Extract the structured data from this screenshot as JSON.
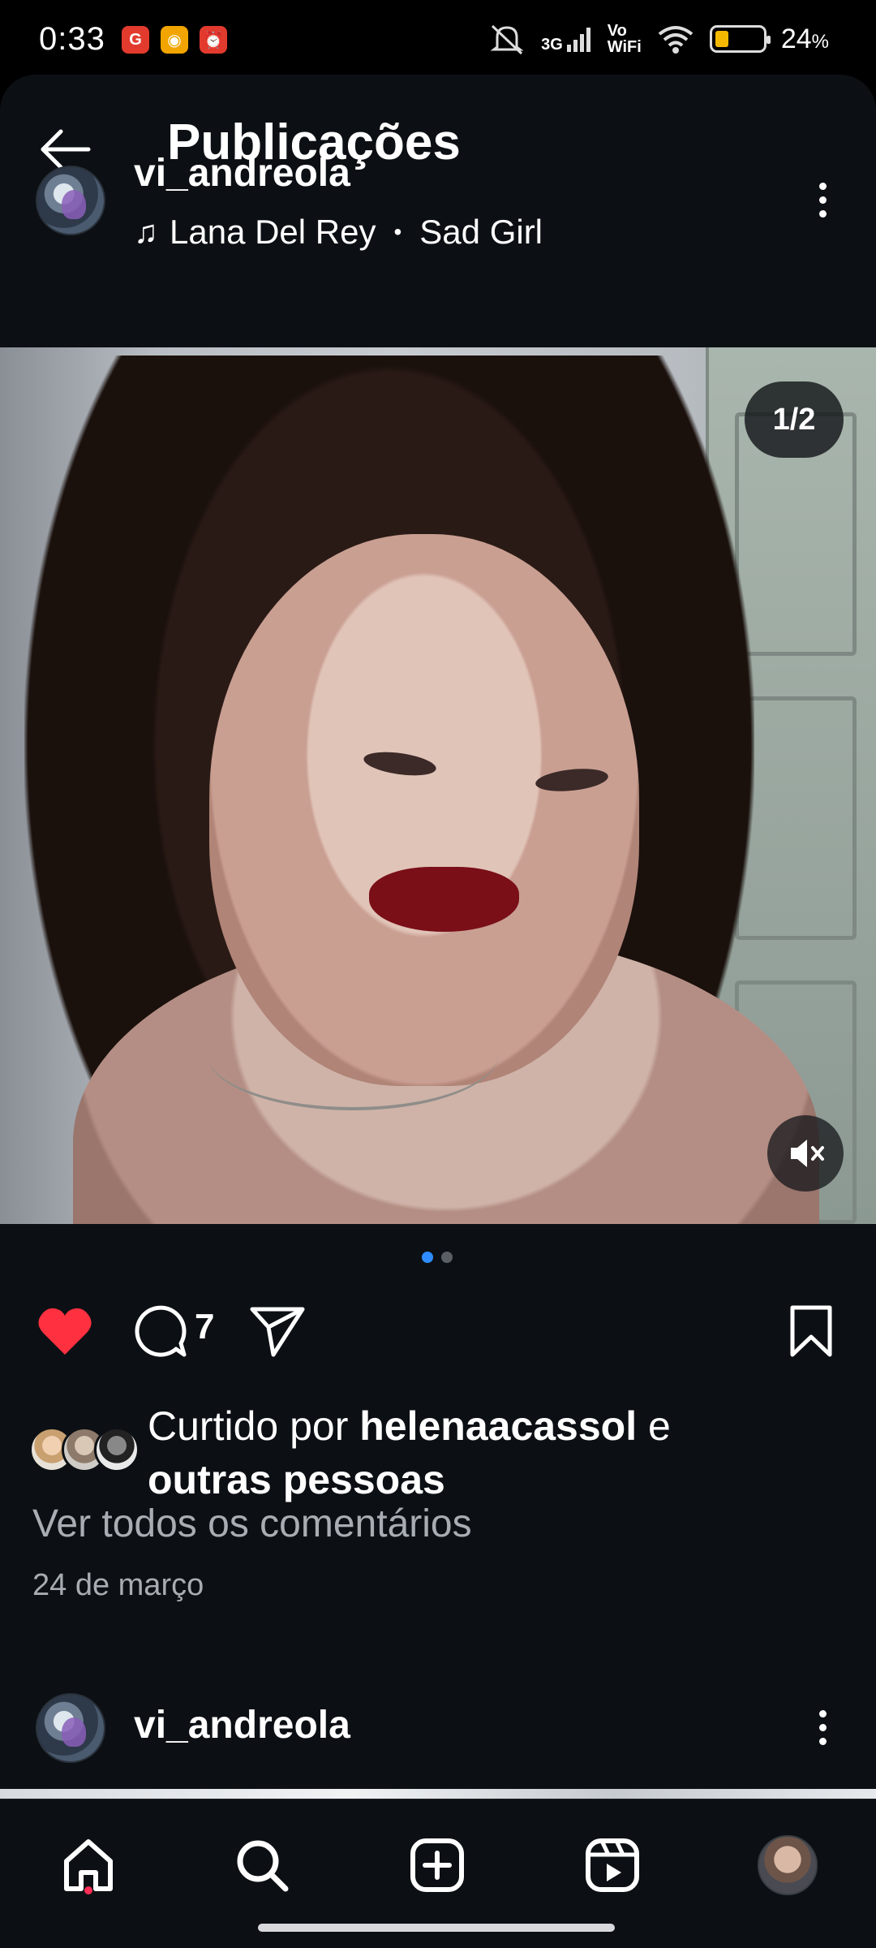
{
  "status_bar": {
    "time": "0:33",
    "battery_percent": "24",
    "battery_percent_sign": "%",
    "network_labels": {
      "signal": "3G",
      "volte": "Vo",
      "wifi_calling": "WiFi"
    },
    "notification_icons": [
      "G",
      "◉",
      "⏰"
    ],
    "colors": {
      "g_icon": "#e23b2e",
      "box_icon": "#f2a500",
      "alarm_icon": "#e23b2e",
      "battery_fill": "#f5b800"
    }
  },
  "header": {
    "title": "Publicações",
    "back_icon": "arrow-left-icon"
  },
  "post": {
    "username": "vi_andreola",
    "music": {
      "artist": "Lana Del Rey",
      "separator": "•",
      "song": "Sad Girl"
    },
    "carousel_counter": "1/2",
    "carousel": {
      "current": 1,
      "total": 2
    },
    "likes": {
      "prefix": "Curtido por ",
      "user": "helenaacassol",
      "middle": " e ",
      "suffix": "outras pessoas"
    },
    "comment_count": "7",
    "view_comments": "Ver todos os comentários",
    "date": "24 de março",
    "liked": true,
    "colors": {
      "heart": "#ff3040",
      "active_dot": "#2f8cff"
    }
  },
  "next_post": {
    "username": "vi_andreola"
  },
  "bottom_nav": {
    "items": [
      "home-icon",
      "search-icon",
      "plus-square-icon",
      "reels-icon",
      "profile-avatar"
    ]
  }
}
